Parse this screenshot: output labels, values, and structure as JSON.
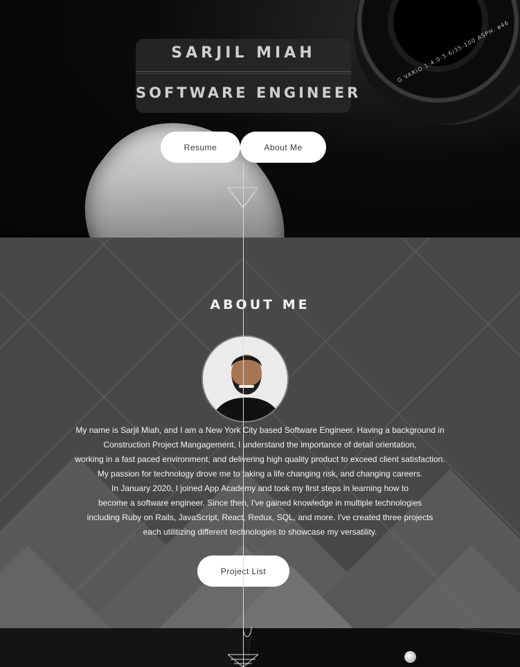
{
  "hero": {
    "name": "SARJIL MIAH",
    "role": "SOFTWARE ENGINEER",
    "lens_text": "G VARIO 1:4.0-5.6/35-100 ASPH. ø46",
    "buttons": {
      "resume": "Resume",
      "about": "About Me"
    }
  },
  "about": {
    "title": "ABOUT ME",
    "bio_lines": [
      "My name is Sarjil Miah, and I am a New York City based Software Engineer. Having a background in",
      "Construction Project Mangagement, I understand the importance of detail orientation,",
      "working in a fast paced environment, and delivering high quality product to exceed client satisfaction.",
      "My passion for technology drove me to taking a life changing risk, and changing careers.",
      "In January 2020, I joined App Academy and took my first steps in learning how to",
      "become a software engineer. Since then, I've gained knowledge in multiple technologies",
      "including Ruby on Rails, JavaScript, React, Redux, SQL, and more. I've created three projects",
      "each utilitizing different technologies to showcase my versatility."
    ],
    "project_button": "Project List"
  },
  "icons": [
    "camera-lens-icon",
    "mouse-image",
    "profile-avatar",
    "chevron-down-icon"
  ],
  "colors": {
    "section_bg": "#4a4a4b",
    "button_bg": "#ffffff",
    "hero_bg": "#050505"
  }
}
